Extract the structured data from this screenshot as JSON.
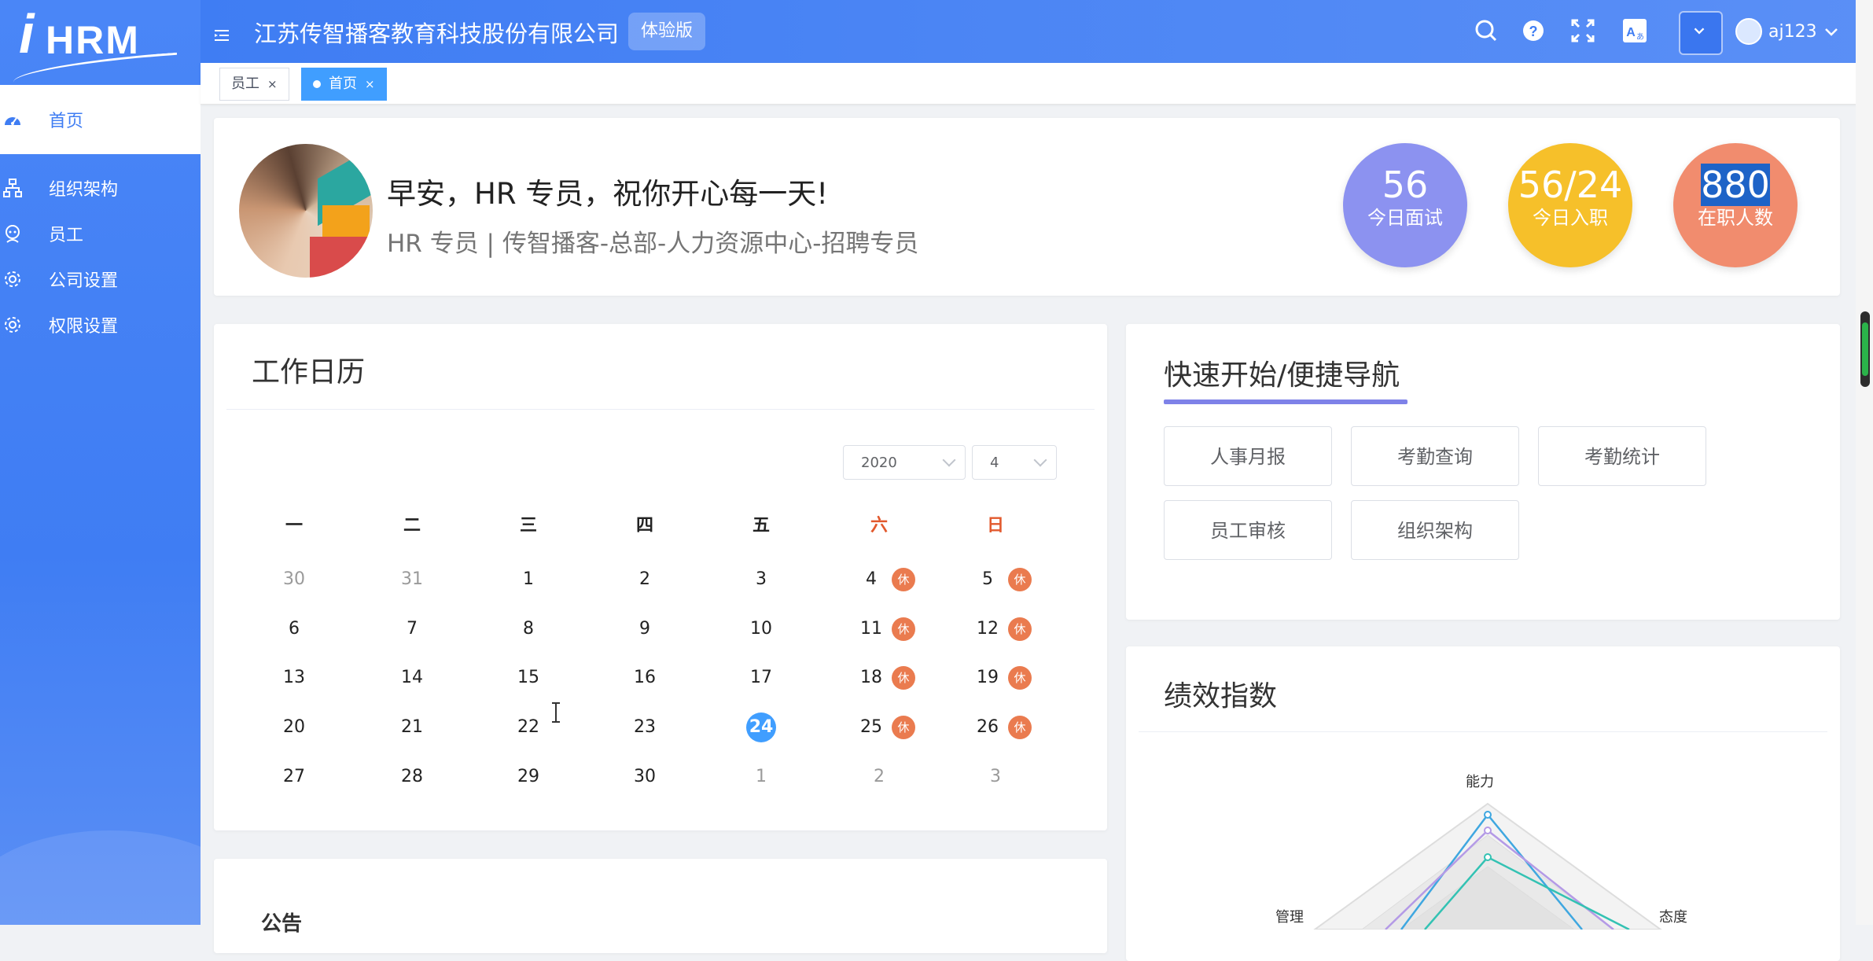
{
  "brand": {
    "logo_i": "i",
    "logo_word": "HRM"
  },
  "sidebar": {
    "items": [
      {
        "label": "首页",
        "icon": "dashboard-icon",
        "active": true
      },
      {
        "label": "组织架构",
        "icon": "org-chart-icon",
        "active": false
      },
      {
        "label": "员工",
        "icon": "employee-icon",
        "active": false
      },
      {
        "label": "公司设置",
        "icon": "gear-icon",
        "active": false
      },
      {
        "label": "权限设置",
        "icon": "gear-icon",
        "active": false
      }
    ]
  },
  "header": {
    "company": "江苏传智播客教育科技股份有限公司",
    "badge": "体验版",
    "username": "aj123",
    "tools": [
      "search-icon",
      "help-icon",
      "fullscreen-icon",
      "language-icon"
    ]
  },
  "tabs": [
    {
      "label": "员工",
      "close": "×",
      "active": false
    },
    {
      "label": "首页",
      "close": "×",
      "active": true
    }
  ],
  "profile": {
    "greeting": "早安，HR 专员，祝你开心每一天!",
    "subtitle": "HR 专员 | 传智播客-总部-人力资源中心-招聘专员",
    "stats": [
      {
        "value": "56",
        "label": "今日面试",
        "color": "#8c92f0"
      },
      {
        "value": "56/24",
        "label": "今日入职",
        "color": "#f6c02a"
      },
      {
        "value": "880",
        "label": "在职人数",
        "color": "#f18c6e"
      }
    ]
  },
  "calendar": {
    "title": "工作日历",
    "year": "2020",
    "month": "4",
    "weekdays": [
      "一",
      "二",
      "三",
      "四",
      "五",
      "六",
      "日"
    ],
    "rest_label": "休",
    "weeks": [
      [
        {
          "d": "30",
          "m": true
        },
        {
          "d": "31",
          "m": true
        },
        {
          "d": "1"
        },
        {
          "d": "2"
        },
        {
          "d": "3"
        },
        {
          "d": "4",
          "r": true
        },
        {
          "d": "5",
          "r": true
        }
      ],
      [
        {
          "d": "6"
        },
        {
          "d": "7"
        },
        {
          "d": "8"
        },
        {
          "d": "9"
        },
        {
          "d": "10"
        },
        {
          "d": "11",
          "r": true
        },
        {
          "d": "12",
          "r": true
        }
      ],
      [
        {
          "d": "13"
        },
        {
          "d": "14"
        },
        {
          "d": "15"
        },
        {
          "d": "16"
        },
        {
          "d": "17"
        },
        {
          "d": "18",
          "r": true
        },
        {
          "d": "19",
          "r": true
        }
      ],
      [
        {
          "d": "20"
        },
        {
          "d": "21"
        },
        {
          "d": "22"
        },
        {
          "d": "23"
        },
        {
          "d": "24",
          "t": true
        },
        {
          "d": "25",
          "r": true
        },
        {
          "d": "26",
          "r": true
        }
      ],
      [
        {
          "d": "27"
        },
        {
          "d": "28"
        },
        {
          "d": "29"
        },
        {
          "d": "30"
        },
        {
          "d": "1",
          "m": true
        },
        {
          "d": "2",
          "m": true
        },
        {
          "d": "3",
          "m": true
        }
      ]
    ]
  },
  "notice": {
    "title": "公告"
  },
  "quick_nav": {
    "title": "快速开始/便捷导航",
    "buttons": [
      "人事月报",
      "考勤查询",
      "考勤统计",
      "员工审核",
      "组织架构"
    ]
  },
  "performance": {
    "title": "绩效指数",
    "radar_labels": [
      "能力",
      "管理",
      "态度"
    ]
  }
}
